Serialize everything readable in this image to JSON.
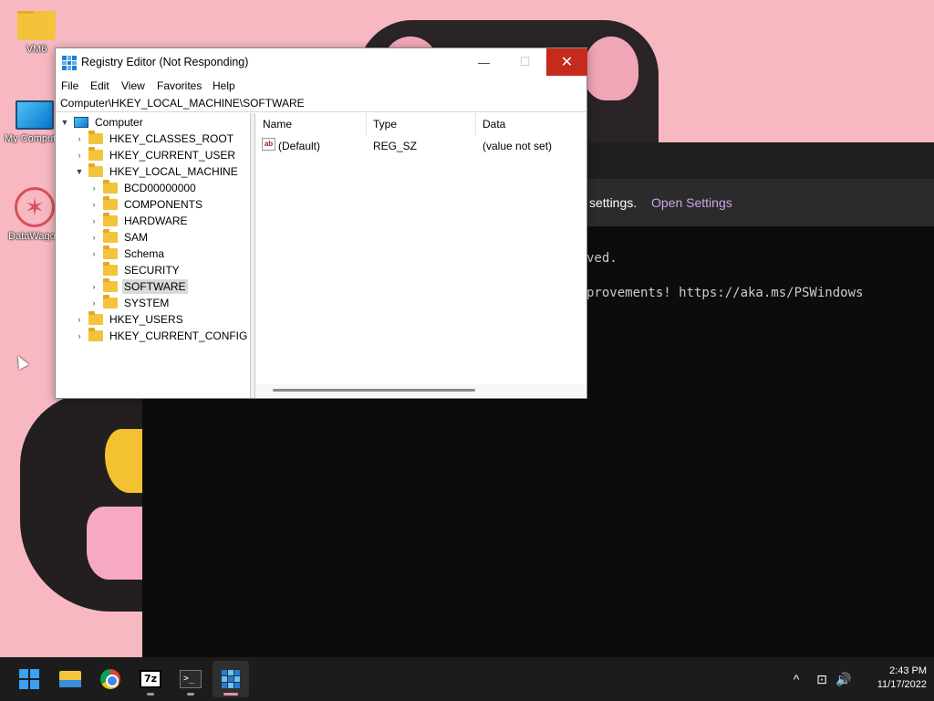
{
  "desktop": {
    "icons": [
      {
        "label": "VM6",
        "icon": "folder-icon"
      },
      {
        "label": "My Computer",
        "icon": "computer-icon"
      },
      {
        "label": "DataWagon",
        "icon": "datawagon-icon"
      }
    ]
  },
  "terminal": {
    "notice_text": "settings.",
    "notice_link": "Open Settings",
    "lines": [
      "ved.",
      "provements! https://aka.ms/PSWindows"
    ]
  },
  "regedit": {
    "title": "Registry Editor (Not Responding)",
    "window_buttons": {
      "minimize": "—",
      "maximize": "☐",
      "close": "✕"
    },
    "menu": [
      "File",
      "Edit",
      "View",
      "Favorites",
      "Help"
    ],
    "address": "Computer\\HKEY_LOCAL_MACHINE\\SOFTWARE",
    "tree": [
      {
        "label": "Computer",
        "level": 0,
        "expanded": true,
        "icon": "computer-icon"
      },
      {
        "label": "HKEY_CLASSES_ROOT",
        "level": 1,
        "expanded": false
      },
      {
        "label": "HKEY_CURRENT_USER",
        "level": 1,
        "expanded": false
      },
      {
        "label": "HKEY_LOCAL_MACHINE",
        "level": 1,
        "expanded": true
      },
      {
        "label": "BCD00000000",
        "level": 2,
        "expanded": false
      },
      {
        "label": "COMPONENTS",
        "level": 2,
        "expanded": false
      },
      {
        "label": "HARDWARE",
        "level": 2,
        "expanded": false
      },
      {
        "label": "SAM",
        "level": 2,
        "expanded": false
      },
      {
        "label": "Schema",
        "level": 2,
        "expanded": false
      },
      {
        "label": "SECURITY",
        "level": 2,
        "expanded": null
      },
      {
        "label": "SOFTWARE",
        "level": 2,
        "expanded": false,
        "selected": true
      },
      {
        "label": "SYSTEM",
        "level": 2,
        "expanded": false
      },
      {
        "label": "HKEY_USERS",
        "level": 1,
        "expanded": false
      },
      {
        "label": "HKEY_CURRENT_CONFIG",
        "level": 1,
        "expanded": false
      }
    ],
    "columns": [
      "Name",
      "Type",
      "Data"
    ],
    "values": [
      {
        "name": "(Default)",
        "type": "REG_SZ",
        "data": "(value not set)",
        "icon": "string-value-icon"
      }
    ]
  },
  "taskbar": {
    "apps": [
      {
        "name": "start",
        "icon": "windows-start-icon"
      },
      {
        "name": "file-explorer",
        "icon": "folder-icon"
      },
      {
        "name": "chrome",
        "icon": "chrome-icon"
      },
      {
        "name": "7-zip",
        "icon": "sevenzip-icon",
        "glyph": "7z"
      },
      {
        "name": "terminal",
        "icon": "terminal-icon",
        "glyph": ">_"
      },
      {
        "name": "registry-editor",
        "icon": "regedit-icon",
        "active": true
      }
    ],
    "tray": {
      "chevron": "^",
      "network": "⊡",
      "volume": "🔊"
    },
    "time": "2:43 PM",
    "date": "11/17/2022"
  },
  "colors": {
    "wallpaper": "#f7b8c2",
    "close_button": "#c42b1c",
    "taskbar": "#1c1c1c",
    "link_purple": "#c7a6e8"
  }
}
